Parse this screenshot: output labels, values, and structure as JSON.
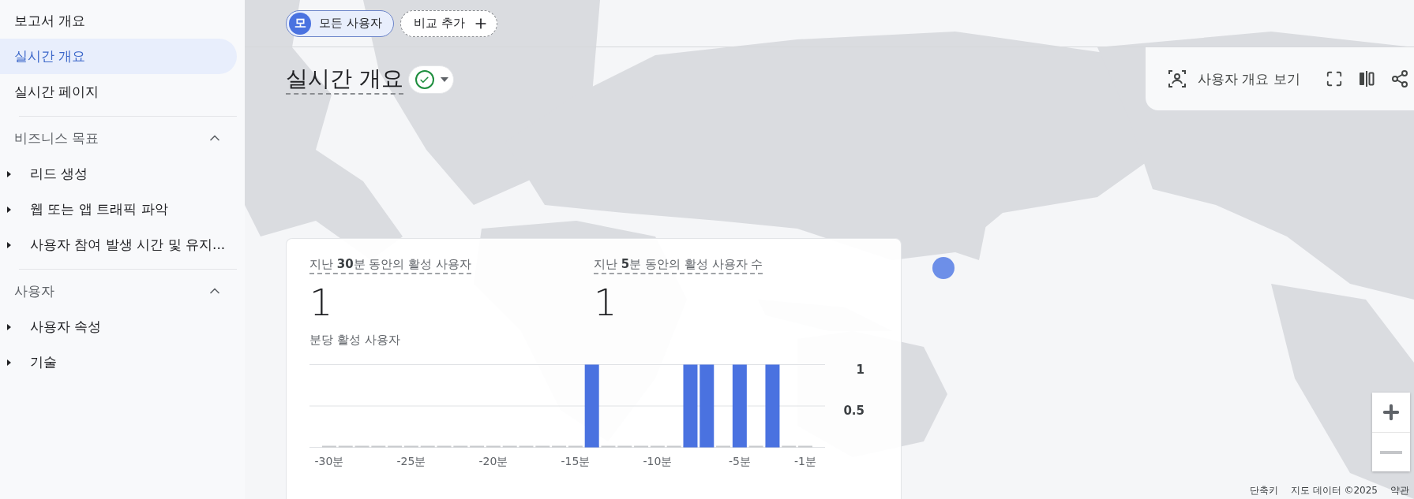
{
  "sidebar": {
    "items": [
      {
        "label": "보고서 개요",
        "selected": false
      },
      {
        "label": "실시간 개요",
        "selected": true
      },
      {
        "label": "실시간 페이지",
        "selected": false
      }
    ],
    "sections": [
      {
        "title": "비즈니스 목표",
        "expanded": true,
        "items": [
          {
            "label": "리드 생성",
            "expanded": false
          },
          {
            "label": "웹 또는 앱 트래픽 파악",
            "expanded": false
          },
          {
            "label": "사용자 참여 발생 시간 및 유지...",
            "expanded": false
          }
        ]
      },
      {
        "title": "사용자",
        "expanded": true,
        "items": [
          {
            "label": "사용자 속성",
            "expanded": false
          },
          {
            "label": "기술",
            "expanded": false
          }
        ]
      }
    ]
  },
  "comparison_bar": {
    "chips": [
      {
        "kind": "segment",
        "avatar": "모",
        "label": "모든 사용자"
      },
      {
        "kind": "add",
        "label": "비교 추가"
      }
    ]
  },
  "title": "실시간 개요",
  "toolbar": {
    "view_button": "사용자 개요 보기"
  },
  "card": {
    "metrics": [
      {
        "label": "지난 **30**분 동안의 활성 사용자",
        "value": "1"
      },
      {
        "label": "지난 **5**분 동안의 활성 사용자 수",
        "value": "1"
      }
    ],
    "chart_data": {
      "type": "bar",
      "title": "분당 활성 사용자",
      "xlim": [
        -31.2,
        0.2
      ],
      "x": [
        -30,
        -29,
        -28,
        -27,
        -26,
        -25,
        -24,
        -23,
        -22,
        -21,
        -20,
        -19,
        -18,
        -17,
        -16,
        -15,
        -14,
        -13,
        -12,
        -11,
        -10,
        -9,
        -8,
        -7,
        -6,
        -5,
        -4,
        -3,
        -2,
        -1
      ],
      "series": [
        {
          "color": "#4a72e0",
          "values": [
            0,
            0,
            0,
            0,
            0,
            0,
            0,
            0,
            0,
            0,
            0,
            0,
            0,
            0,
            0,
            0,
            1,
            0,
            0,
            0,
            0,
            0,
            1,
            1,
            0,
            1,
            0,
            1,
            0,
            0
          ]
        }
      ],
      "ylim": [
        0,
        1
      ],
      "yticks": [
        0.5,
        1
      ],
      "xticks": [
        {
          "value": -30,
          "label": "-30분"
        },
        {
          "value": -25,
          "label": "-25분"
        },
        {
          "value": -20,
          "label": "-20분"
        },
        {
          "value": -15,
          "label": "-15분"
        },
        {
          "value": -10,
          "label": "-10분"
        },
        {
          "value": -5,
          "label": "-5분"
        },
        {
          "value": -1,
          "label": "-1분"
        }
      ]
    }
  },
  "map_controls": {
    "zoom_out_disabled": true
  },
  "attribution": [
    "단축키",
    "지도 데이터 ©2025",
    "약관"
  ]
}
